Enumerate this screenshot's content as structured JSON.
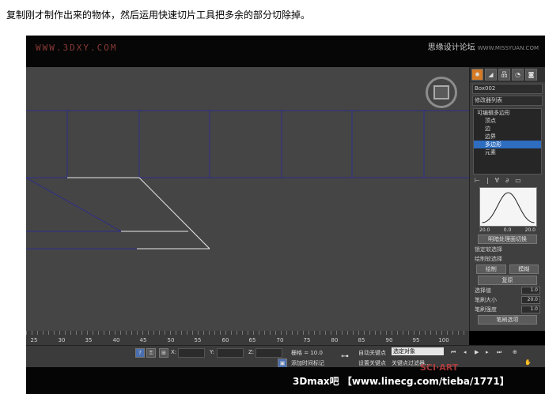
{
  "caption": "复制刚才制作出来的物体，然后运用快速切片工具把多余的部分切除掉。",
  "watermark_left": "WWW.3DXY.COM",
  "watermark_right": "思缘设计论坛",
  "watermark_right_small": "WWW.MISSYUAN.COM",
  "panel": {
    "tabs": [
      "✹",
      "◢",
      "品",
      "◔",
      "◙"
    ],
    "object_name": "Box002",
    "modifier_list": "修改器列表",
    "stack": {
      "root": "可编辑多边形",
      "items": [
        "顶点",
        "边",
        "边界",
        "多边形",
        "元素"
      ]
    },
    "tool_icons": [
      "⊢",
      "|",
      "∀",
      "∂",
      "▭"
    ],
    "graph_labels": [
      "20.0",
      "0.0",
      "20.0"
    ],
    "shrink_btn": "明暗处理面切换",
    "lock_soft": "锁定软选择",
    "paint_group": "绘制软选择",
    "paint_btn": "绘制",
    "blur_btn": "模糊",
    "revert_btn": "复原",
    "rows": [
      {
        "label": "选择值",
        "value": "1.0"
      },
      {
        "label": "笔刷大小",
        "value": "20.0"
      },
      {
        "label": "笔刷强度",
        "value": "1.0"
      }
    ],
    "brush_options": "笔刷选项"
  },
  "timeline_ticks": [
    "25",
    "30",
    "35",
    "40",
    "45",
    "50",
    "55",
    "60",
    "65",
    "70",
    "75",
    "80",
    "85",
    "90",
    "95",
    "100"
  ],
  "status": {
    "x_label": "X:",
    "y_label": "Y:",
    "z_label": "Z:",
    "grid_label": "栅格 = 10.0",
    "add_time_tag": "添加时间标记",
    "autokey": "自动关键点",
    "setkey": "设置关键点",
    "selected_object": "选定对象",
    "key_filters": "关键点过滤器..."
  },
  "bottom_text": "3Dmax吧 【www.linecg.com/tieba/1771】",
  "bottom_stamp": "SCI·ART"
}
